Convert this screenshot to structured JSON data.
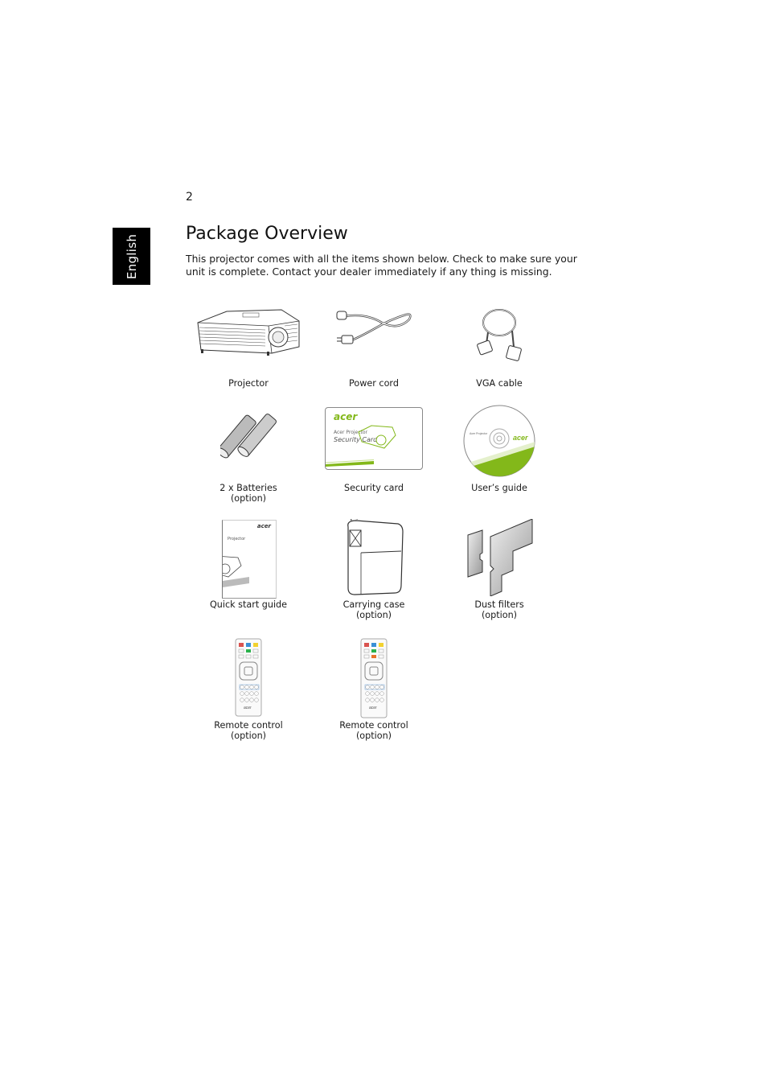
{
  "page": {
    "number": "2",
    "language_tab": "English",
    "title": "Package Overview",
    "intro": "This projector comes with all the items shown below. Check to make sure your unit is complete. Contact your dealer immediately if any thing is missing."
  },
  "items": [
    {
      "name": "Projector",
      "note": ""
    },
    {
      "name": "Power cord",
      "note": ""
    },
    {
      "name": "VGA cable",
      "note": ""
    },
    {
      "name": "2 x Batteries",
      "note": "(option)"
    },
    {
      "name": "Security card",
      "note": ""
    },
    {
      "name": "User’s guide",
      "note": ""
    },
    {
      "name": "Quick start guide",
      "note": ""
    },
    {
      "name": "Carrying case",
      "note": "(option)"
    },
    {
      "name": "Dust filters",
      "note": "(option)"
    },
    {
      "name": "Remote control",
      "note": "(option)"
    },
    {
      "name": "Remote control",
      "note": "(option)"
    }
  ],
  "art_text": {
    "brand": "acer",
    "card_line1": "Acer Projector",
    "card_line2": "Security Card",
    "guide_label": "Projector",
    "cd_label": "Acer Projector"
  },
  "colors": {
    "acer_green": "#83b81a",
    "tab_bg": "#000000",
    "remote_red": "#d9534f",
    "remote_blue": "#3a8fd6",
    "remote_yellow": "#f2d230",
    "remote_green": "#2bb24c",
    "remote_orange": "#e8732a"
  }
}
